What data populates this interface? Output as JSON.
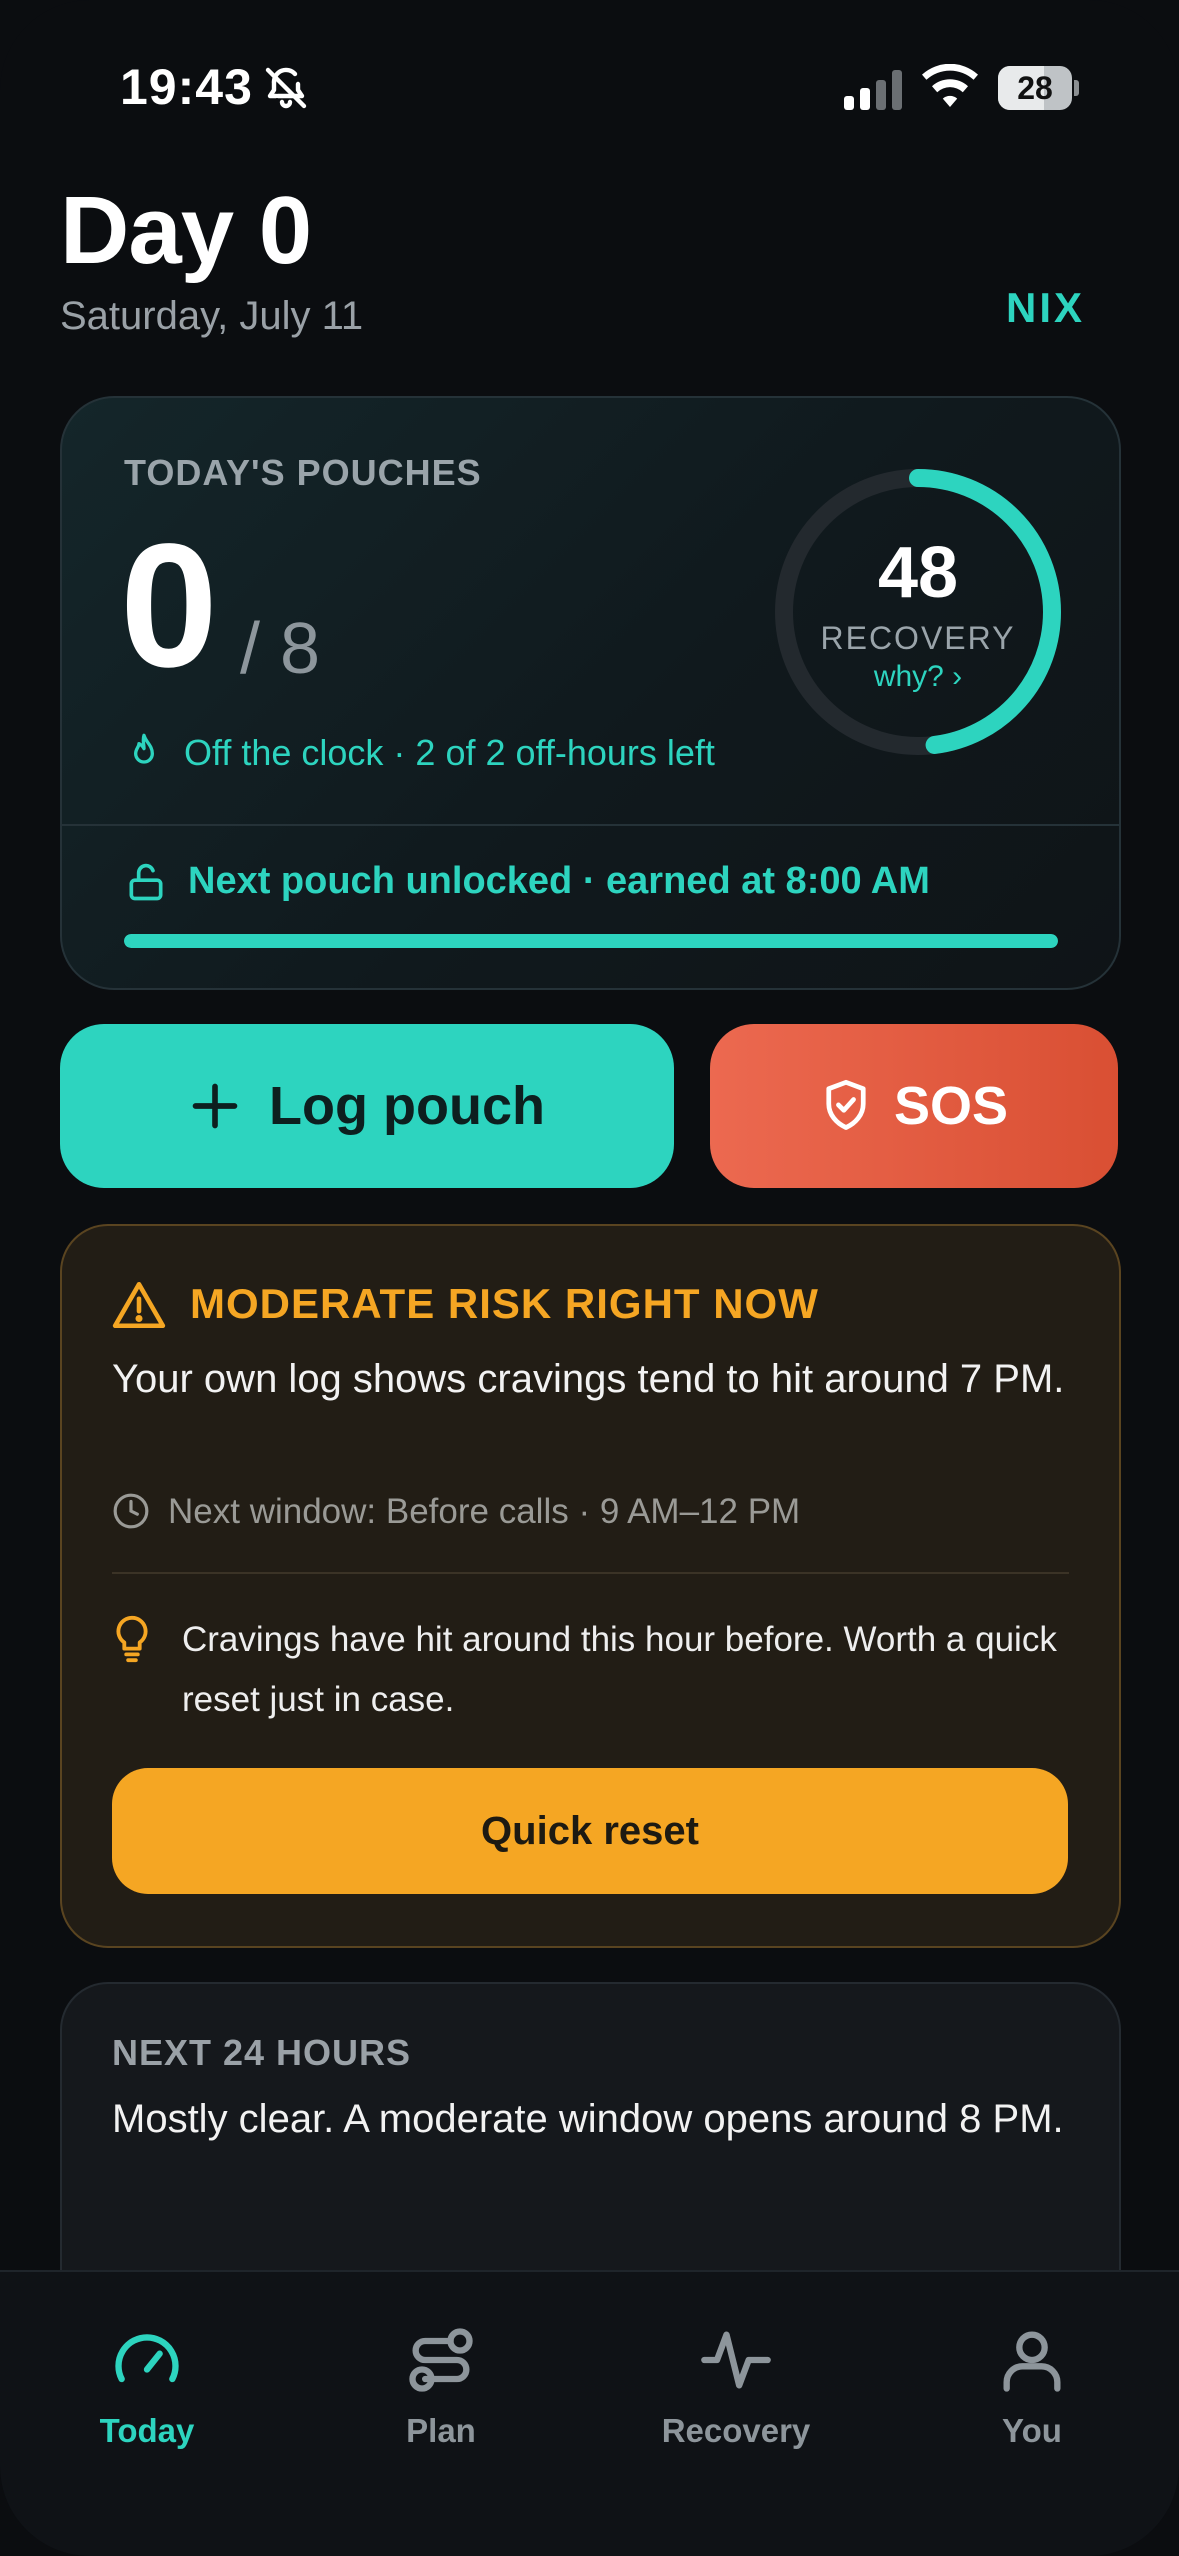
{
  "status_bar": {
    "time": "19:43",
    "battery": "28"
  },
  "header": {
    "title": "Day 0",
    "date": "Saturday, July 11",
    "brand": "NIX"
  },
  "pouches": {
    "label": "TODAY'S POUCHES",
    "count": "0",
    "total": "/ 8",
    "status": "Off the clock · 2 of 2 off-hours left",
    "recovery_score": "48",
    "recovery_label": "RECOVERY",
    "recovery_why": "why? ›",
    "recovery_fraction": 0.48,
    "unlock_text": "Next pouch unlocked · earned at 8:00 AM",
    "unlock_progress": 1.0
  },
  "actions": {
    "log_label": "Log pouch",
    "sos_label": "SOS"
  },
  "risk": {
    "title": "MODERATE RISK RIGHT NOW",
    "body": "Your own log shows cravings tend to hit around 7 PM.",
    "next_window": "Next window: Before calls · 9 AM–12 PM",
    "tip": "Cravings have hit around this hour before. Worth a quick reset just in case.",
    "button": "Quick reset"
  },
  "next24": {
    "label": "NEXT 24 HOURS",
    "body": "Mostly clear. A moderate window opens around 8 PM."
  },
  "tabs": [
    {
      "label": "Today",
      "icon": "gauge-icon",
      "active": true
    },
    {
      "label": "Plan",
      "icon": "route-icon",
      "active": false
    },
    {
      "label": "Recovery",
      "icon": "pulse-icon",
      "active": false
    },
    {
      "label": "You",
      "icon": "person-icon",
      "active": false
    }
  ],
  "colors": {
    "accent": "#2dd4bf",
    "sos": "#e25d41",
    "warning": "#f5a623",
    "background": "#0b0d10"
  }
}
